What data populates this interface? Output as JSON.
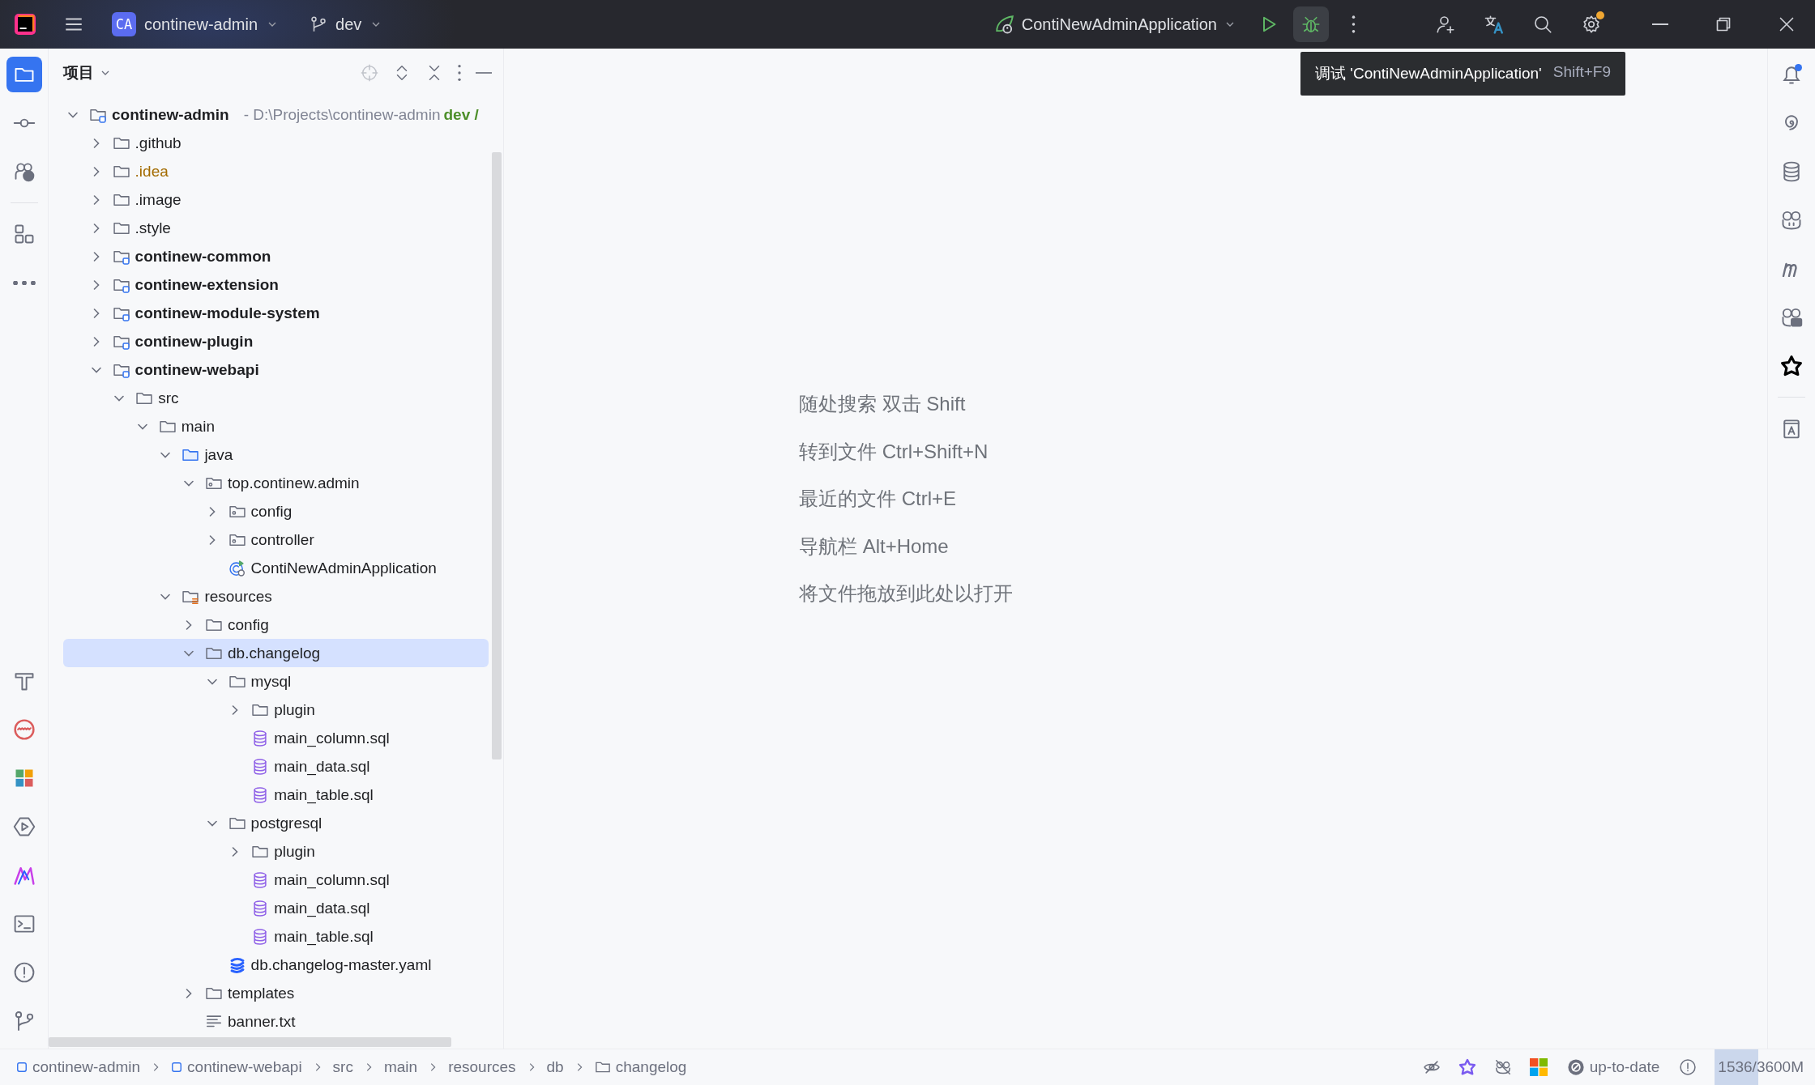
{
  "title_bar": {
    "project_badge": "CA",
    "project": "continew-admin",
    "branch": "dev",
    "run_config": "ContiNewAdminApplication",
    "settings_update": true
  },
  "tooltip": {
    "text": "调试 'ContiNewAdminApplication'",
    "shortcut": "Shift+F9"
  },
  "left_stripe": [
    {
      "kind": "project",
      "selected": true
    },
    {
      "kind": "commit",
      "selected": false
    },
    {
      "kind": "help",
      "selected": false
    },
    {
      "kind": "structure",
      "selected": false
    },
    {
      "kind": "more",
      "selected": false
    },
    {
      "kind": "build",
      "selected": false
    },
    {
      "kind": "profiler",
      "selected": false
    },
    {
      "kind": "tiles",
      "selected": false
    },
    {
      "kind": "services",
      "selected": false
    },
    {
      "kind": "plugin",
      "selected": false
    },
    {
      "kind": "terminal",
      "selected": false
    },
    {
      "kind": "problems",
      "selected": false
    },
    {
      "kind": "git",
      "selected": false
    }
  ],
  "project_panel": {
    "title": "项目",
    "tree": [
      {
        "name": "continew-admin",
        "kind": "module",
        "path": "- D:\\Projects\\continew-admin",
        "branch": "dev /",
        "expanded": true,
        "selected": false,
        "children": [
          {
            "name": ".github",
            "kind": "folder",
            "expanded": false,
            "selected": false
          },
          {
            "name": ".idea",
            "kind": "folder",
            "color": "#a36b00",
            "expanded": false,
            "selected": false
          },
          {
            "name": ".image",
            "kind": "folder",
            "expanded": false,
            "selected": false
          },
          {
            "name": ".style",
            "kind": "folder",
            "expanded": false,
            "selected": false
          },
          {
            "name": "continew-common",
            "kind": "module",
            "expanded": false,
            "selected": false
          },
          {
            "name": "continew-extension",
            "kind": "module",
            "expanded": false,
            "selected": false
          },
          {
            "name": "continew-module-system",
            "kind": "module",
            "expanded": false,
            "selected": false
          },
          {
            "name": "continew-plugin",
            "kind": "module",
            "expanded": false,
            "selected": false
          },
          {
            "name": "continew-webapi",
            "kind": "module",
            "expanded": true,
            "selected": false,
            "children": [
              {
                "name": "src",
                "kind": "folder",
                "expanded": true,
                "selected": false,
                "children": [
                  {
                    "name": "main",
                    "kind": "folder",
                    "expanded": true,
                    "selected": false,
                    "children": [
                      {
                        "name": "java",
                        "kind": "source-root",
                        "expanded": true,
                        "selected": false,
                        "children": [
                          {
                            "name": "top.continew.admin",
                            "kind": "package",
                            "expanded": true,
                            "selected": false,
                            "children": [
                              {
                                "name": "config",
                                "kind": "package",
                                "expanded": false,
                                "selected": false
                              },
                              {
                                "name": "controller",
                                "kind": "package",
                                "expanded": false,
                                "selected": false
                              },
                              {
                                "name": "ContiNewAdminApplication",
                                "kind": "app-class",
                                "selected": false
                              }
                            ]
                          }
                        ]
                      },
                      {
                        "name": "resources",
                        "kind": "resources-root",
                        "expanded": true,
                        "selected": false,
                        "children": [
                          {
                            "name": "config",
                            "kind": "folder",
                            "expanded": false,
                            "selected": false
                          },
                          {
                            "name": "db.changelog",
                            "kind": "folder",
                            "expanded": true,
                            "selected": true,
                            "children": [
                              {
                                "name": "mysql",
                                "kind": "folder",
                                "expanded": true,
                                "selected": false,
                                "children": [
                                  {
                                    "name": "plugin",
                                    "kind": "folder",
                                    "expanded": false,
                                    "selected": false
                                  },
                                  {
                                    "name": "main_column.sql",
                                    "kind": "sql",
                                    "selected": false
                                  },
                                  {
                                    "name": "main_data.sql",
                                    "kind": "sql",
                                    "selected": false
                                  },
                                  {
                                    "name": "main_table.sql",
                                    "kind": "sql",
                                    "selected": false
                                  }
                                ]
                              },
                              {
                                "name": "postgresql",
                                "kind": "folder",
                                "expanded": true,
                                "selected": false,
                                "children": [
                                  {
                                    "name": "plugin",
                                    "kind": "folder",
                                    "expanded": false,
                                    "selected": false
                                  },
                                  {
                                    "name": "main_column.sql",
                                    "kind": "sql",
                                    "selected": false
                                  },
                                  {
                                    "name": "main_data.sql",
                                    "kind": "sql",
                                    "selected": false
                                  },
                                  {
                                    "name": "main_table.sql",
                                    "kind": "sql",
                                    "selected": false
                                  }
                                ]
                              },
                              {
                                "name": "db.changelog-master.yaml",
                                "kind": "liquibase",
                                "selected": false
                              }
                            ]
                          },
                          {
                            "name": "templates",
                            "kind": "folder",
                            "expanded": false,
                            "selected": false
                          },
                          {
                            "name": "banner.txt",
                            "kind": "text",
                            "selected": false
                          }
                        ]
                      }
                    ]
                  }
                ]
              }
            ]
          }
        ]
      }
    ]
  },
  "editor_hints": [
    "随处搜索 双击 Shift",
    "转到文件 Ctrl+Shift+N",
    "最近的文件 Ctrl+E",
    "导航栏 Alt+Home",
    "将文件拖放到此处以打开"
  ],
  "right_stripe": {
    "notifications_unread": true
  },
  "breadcrumbs": [
    {
      "label": "continew-admin",
      "kind": "module"
    },
    {
      "label": "continew-webapi",
      "kind": "module"
    },
    {
      "label": "src",
      "kind": "plain"
    },
    {
      "label": "main",
      "kind": "plain"
    },
    {
      "label": "resources",
      "kind": "plain"
    },
    {
      "label": "db",
      "kind": "plain"
    },
    {
      "label": "changelog",
      "kind": "folder"
    }
  ],
  "status_bar": {
    "vcs": "up-to-date",
    "memory": {
      "text": "1536/3600M",
      "level": 0.43
    }
  }
}
